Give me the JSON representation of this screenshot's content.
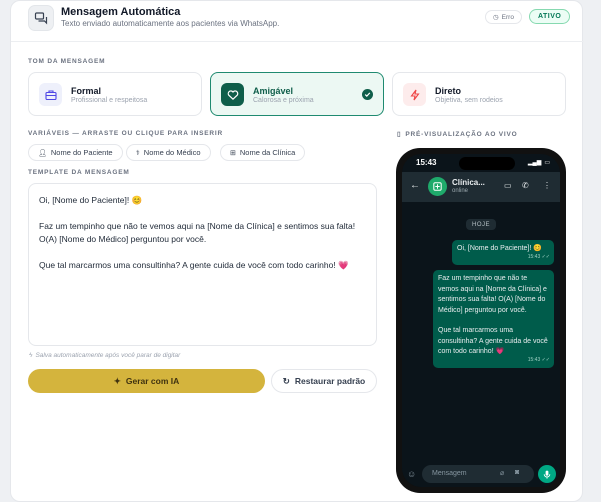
{
  "header": {
    "title": "Mensagem Automática",
    "subtitle": "Texto enviado automaticamente aos pacientes via WhatsApp.",
    "badge_error": "Erro",
    "badge_active": "ATIVO"
  },
  "tone": {
    "label": "TOM DA MENSAGEM",
    "options": [
      {
        "title": "Formal",
        "subtitle": "Profissional e respeitosa"
      },
      {
        "title": "Amigável",
        "subtitle": "Calorosa e próxima"
      },
      {
        "title": "Direto",
        "subtitle": "Objetiva, sem rodeios"
      }
    ],
    "selected": "Amigável"
  },
  "variables": {
    "label": "VARIÁVEIS — ARRASTE OU CLIQUE PARA INSERIR",
    "chips": [
      "Nome do Paciente",
      "Nome do Médico",
      "Nome da Clínica"
    ]
  },
  "template": {
    "label": "TEMPLATE DA MENSAGEM",
    "line1": "Oi, [Nome do Paciente]! 😊",
    "line2": "Faz um tempinho que não te vemos aqui na [Nome da Clínica] e sentimos sua falta! O(A) [Nome do Médico] perguntou por você.",
    "line3": "Que tal marcarmos uma consultinha? A gente cuida de você com todo carinho! 💗",
    "hint": "Salva automaticamente após você parar de digitar"
  },
  "buttons": {
    "generate": "Gerar com IA",
    "reset": "Restaurar padrão"
  },
  "preview": {
    "label": "PRÉ-VISUALIZAÇÃO AO VIVO",
    "time": "15:43",
    "contact_name": "Clínica...",
    "contact_status": "online",
    "day": "HOJE",
    "msg1": "Oi, [Nome do Paciente]! 😊",
    "msg1_time": "15:43 ✓✓",
    "msg2_p1": "Faz um tempinho que não te vemos aqui na [Nome da Clínica] e sentimos sua falta! O(A) [Nome do Médico] perguntou por você.",
    "msg2_p2": "Que tal marcarmos uma consultinha? A gente cuida de você com todo carinho! 💗",
    "msg2_time": "15:43 ✓✓",
    "input_placeholder": "Mensagem"
  },
  "colors": {
    "accent": "#0f5e4a",
    "generate_button": "#d4b43d",
    "bubble": "#005c4b"
  }
}
